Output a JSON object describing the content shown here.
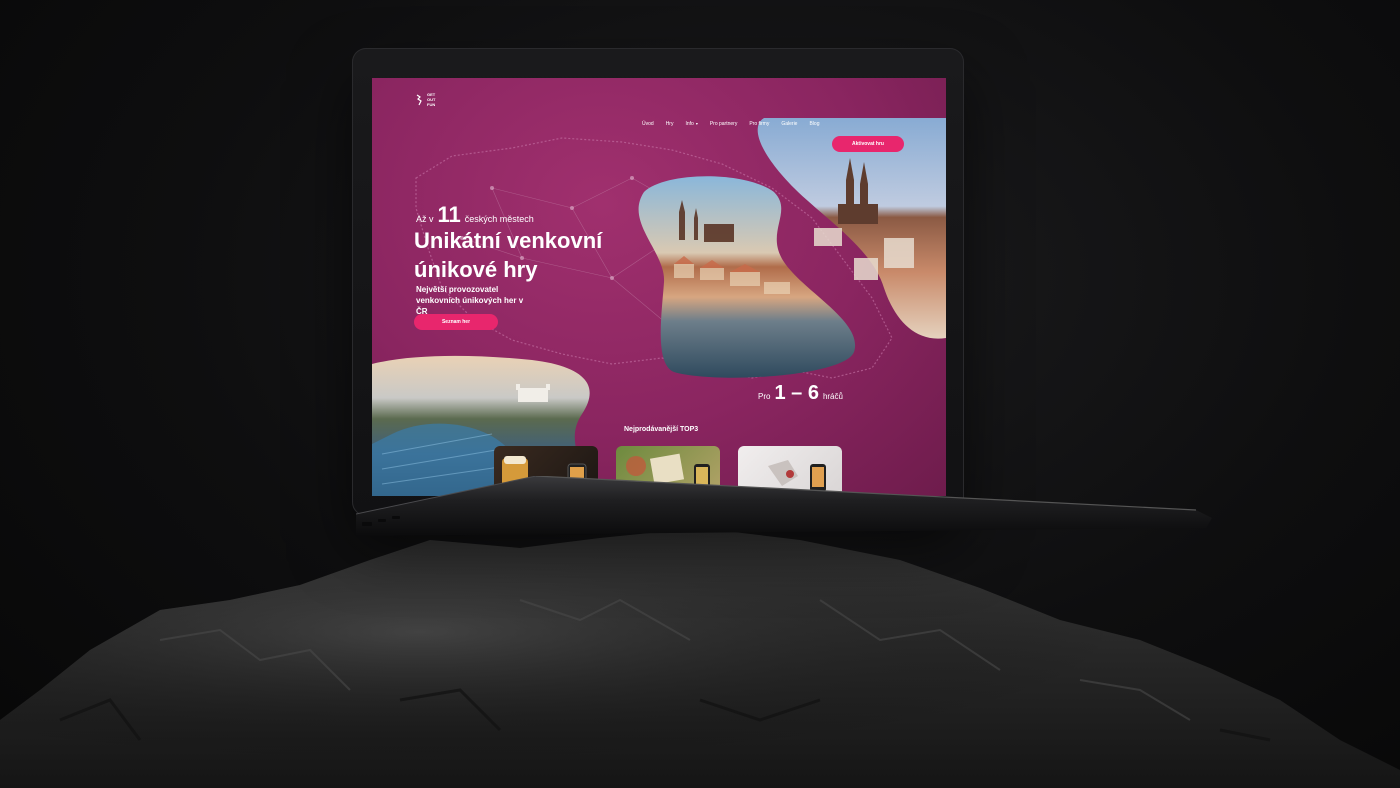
{
  "site": {
    "logo": {
      "lines": [
        "GET",
        "OUT",
        "FUN"
      ]
    },
    "nav": {
      "items": [
        {
          "label": "Úvod"
        },
        {
          "label": "Hry"
        },
        {
          "label": "Info"
        },
        {
          "label": "Pro partnery"
        },
        {
          "label": "Pro firmy"
        },
        {
          "label": "Galerie"
        },
        {
          "label": "Blog"
        }
      ],
      "cta_label": "Aktivovat hru"
    },
    "hero": {
      "pre_text": "Až v",
      "pre_number": "11",
      "pre_suffix": "českých městech",
      "title": "Unikátní venkovní únikové hry",
      "subtitle": "Největší provozovatel venkovních únikových her v ČR",
      "button_label": "Seznam her"
    },
    "players": {
      "prefix": "Pro",
      "range": "1 – 6",
      "suffix": "hráčů"
    },
    "top_section": {
      "title": "Nejprodávanější TOP3"
    }
  },
  "colors": {
    "brand_magenta": "#8a2560",
    "accent_pink": "#e8266d",
    "background": "#0e0e0f"
  },
  "icons": [
    "chevron-down-icon",
    "logo-mark-icon"
  ]
}
